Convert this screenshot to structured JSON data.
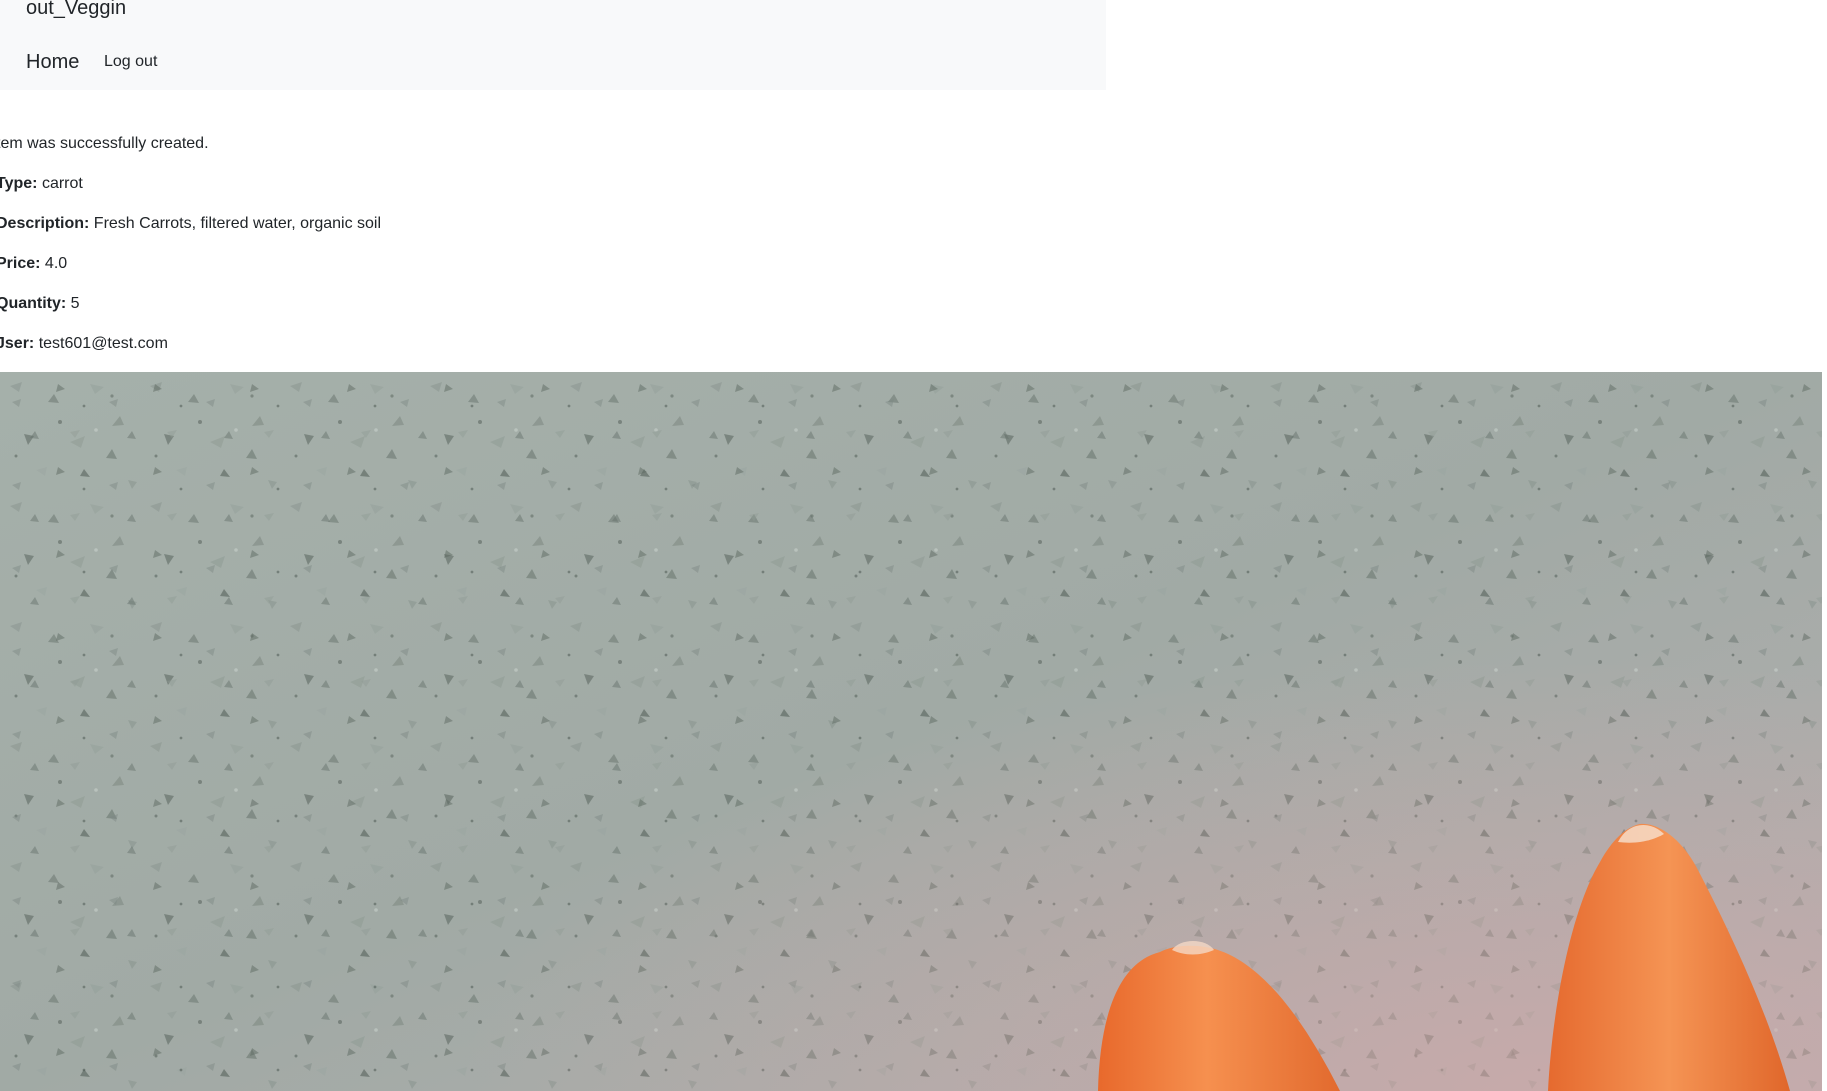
{
  "navbar": {
    "brand": "out_Veggin",
    "home": "Home",
    "logout": "Log out"
  },
  "notice": "tem was successfully created.",
  "item": {
    "type_label": "Type:",
    "type_value": "carrot",
    "description_label": "Description:",
    "description_value": "Fresh Carrots, filtered water, organic soil",
    "price_label": "Price:",
    "price_value": "4.0",
    "quantity_label": "Quantity:",
    "quantity_value": "5",
    "user_label": "Jser:",
    "user_value": "test601@test.com"
  },
  "colors": {
    "navbar_bg": "#f8f9fa",
    "countertop": "#a3aca7",
    "carrot": "#f07a3a"
  }
}
